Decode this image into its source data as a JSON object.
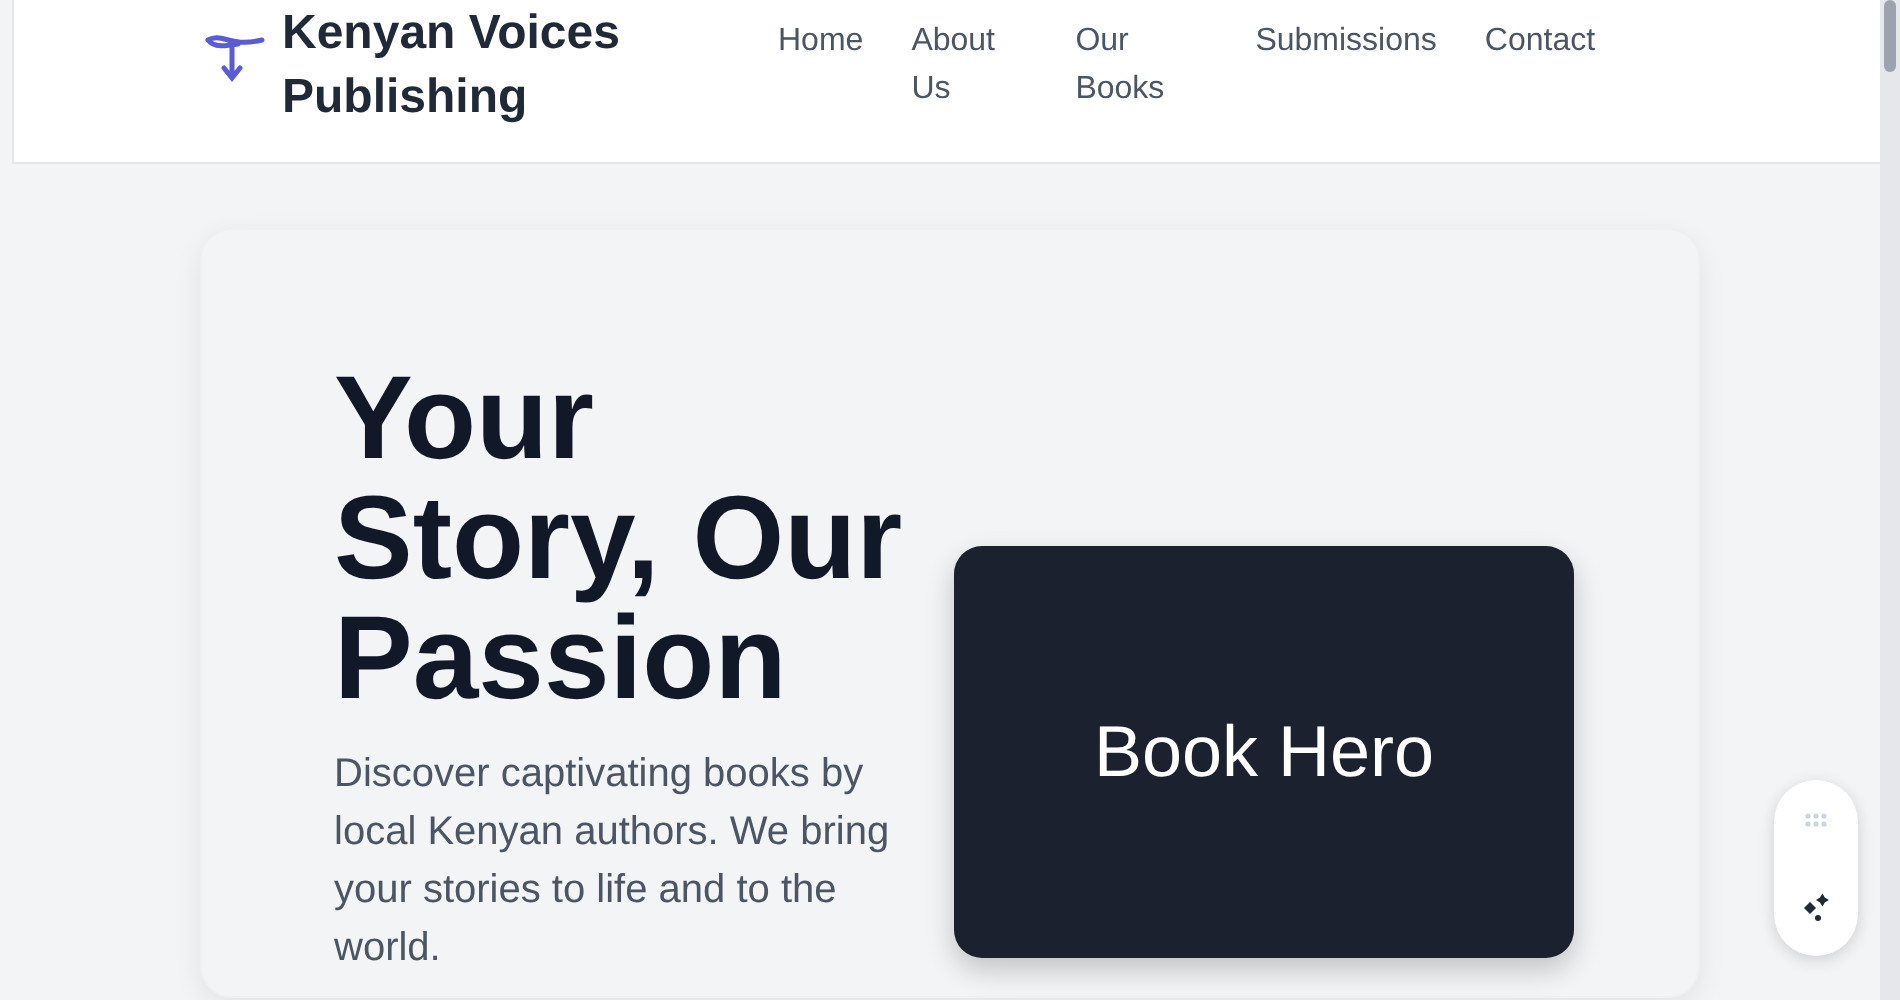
{
  "header": {
    "brand": "Kenyan Voices Publishing",
    "nav": [
      {
        "label": "Home"
      },
      {
        "label": "About Us"
      },
      {
        "label": "Our Books"
      },
      {
        "label": "Submissions"
      },
      {
        "label": "Contact"
      }
    ]
  },
  "hero": {
    "heading": "Your Story, Our Passion",
    "text": "Discover captivating books by local Kenyan authors. We bring your stories to life and to the world.",
    "image_label": "Book Hero"
  }
}
